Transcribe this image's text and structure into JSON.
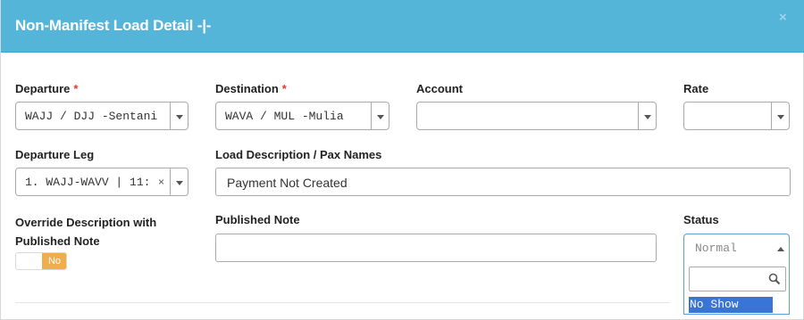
{
  "modal": {
    "title": "Non-Manifest Load Detail -|-",
    "close_label": "×"
  },
  "fields": {
    "departure": {
      "label": "Departure",
      "required_mark": "*",
      "value": "WAJJ / DJJ -Sentani"
    },
    "destination": {
      "label": "Destination",
      "required_mark": "*",
      "value": "WAVA / MUL -Mulia"
    },
    "account": {
      "label": "Account",
      "value": ""
    },
    "rate": {
      "label": "Rate",
      "value": ""
    },
    "departure_leg": {
      "label": "Departure Leg",
      "value": "1. WAJJ-WAVV | 11:",
      "clear_label": "×"
    },
    "load_description": {
      "label": "Load Description / Pax Names",
      "value": "Payment Not Created"
    },
    "override_description": {
      "label_line1": "Override Description with",
      "label_line2": "Published Note",
      "toggle_value": "No"
    },
    "published_note": {
      "label": "Published Note",
      "value": ""
    },
    "status": {
      "label": "Status",
      "placeholder": "Normal",
      "search_value": "",
      "options": [
        "No Show"
      ],
      "highlighted_option": "No Show"
    }
  },
  "colors": {
    "header_bg": "#55b5d9",
    "required": "#e8352c",
    "toggle_off": "#f0ad4e",
    "highlight": "#3875d7"
  }
}
